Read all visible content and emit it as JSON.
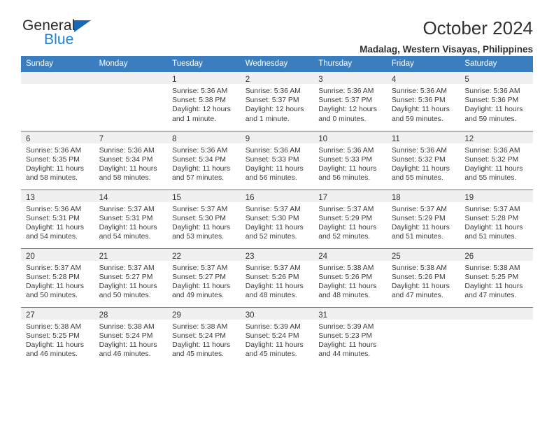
{
  "brand": {
    "name_top": "General",
    "name_bottom": "Blue",
    "accent_color": "#1b84d6",
    "triangle_color": "#1769b5"
  },
  "header": {
    "title": "October 2024",
    "subtitle": "Madalag, Western Visayas, Philippines"
  },
  "calendar": {
    "header_bg": "#3a7ebf",
    "header_text_color": "#ffffff",
    "daynum_band_bg": "#f0f0f0",
    "weekday_headers": [
      "Sunday",
      "Monday",
      "Tuesday",
      "Wednesday",
      "Thursday",
      "Friday",
      "Saturday"
    ],
    "weeks": [
      [
        {
          "day": "",
          "lines": []
        },
        {
          "day": "",
          "lines": []
        },
        {
          "day": "1",
          "lines": [
            "Sunrise: 5:36 AM",
            "Sunset: 5:38 PM",
            "Daylight: 12 hours",
            "and 1 minute."
          ]
        },
        {
          "day": "2",
          "lines": [
            "Sunrise: 5:36 AM",
            "Sunset: 5:37 PM",
            "Daylight: 12 hours",
            "and 1 minute."
          ]
        },
        {
          "day": "3",
          "lines": [
            "Sunrise: 5:36 AM",
            "Sunset: 5:37 PM",
            "Daylight: 12 hours",
            "and 0 minutes."
          ]
        },
        {
          "day": "4",
          "lines": [
            "Sunrise: 5:36 AM",
            "Sunset: 5:36 PM",
            "Daylight: 11 hours",
            "and 59 minutes."
          ]
        },
        {
          "day": "5",
          "lines": [
            "Sunrise: 5:36 AM",
            "Sunset: 5:36 PM",
            "Daylight: 11 hours",
            "and 59 minutes."
          ]
        }
      ],
      [
        {
          "day": "6",
          "lines": [
            "Sunrise: 5:36 AM",
            "Sunset: 5:35 PM",
            "Daylight: 11 hours",
            "and 58 minutes."
          ]
        },
        {
          "day": "7",
          "lines": [
            "Sunrise: 5:36 AM",
            "Sunset: 5:34 PM",
            "Daylight: 11 hours",
            "and 58 minutes."
          ]
        },
        {
          "day": "8",
          "lines": [
            "Sunrise: 5:36 AM",
            "Sunset: 5:34 PM",
            "Daylight: 11 hours",
            "and 57 minutes."
          ]
        },
        {
          "day": "9",
          "lines": [
            "Sunrise: 5:36 AM",
            "Sunset: 5:33 PM",
            "Daylight: 11 hours",
            "and 56 minutes."
          ]
        },
        {
          "day": "10",
          "lines": [
            "Sunrise: 5:36 AM",
            "Sunset: 5:33 PM",
            "Daylight: 11 hours",
            "and 56 minutes."
          ]
        },
        {
          "day": "11",
          "lines": [
            "Sunrise: 5:36 AM",
            "Sunset: 5:32 PM",
            "Daylight: 11 hours",
            "and 55 minutes."
          ]
        },
        {
          "day": "12",
          "lines": [
            "Sunrise: 5:36 AM",
            "Sunset: 5:32 PM",
            "Daylight: 11 hours",
            "and 55 minutes."
          ]
        }
      ],
      [
        {
          "day": "13",
          "lines": [
            "Sunrise: 5:36 AM",
            "Sunset: 5:31 PM",
            "Daylight: 11 hours",
            "and 54 minutes."
          ]
        },
        {
          "day": "14",
          "lines": [
            "Sunrise: 5:37 AM",
            "Sunset: 5:31 PM",
            "Daylight: 11 hours",
            "and 54 minutes."
          ]
        },
        {
          "day": "15",
          "lines": [
            "Sunrise: 5:37 AM",
            "Sunset: 5:30 PM",
            "Daylight: 11 hours",
            "and 53 minutes."
          ]
        },
        {
          "day": "16",
          "lines": [
            "Sunrise: 5:37 AM",
            "Sunset: 5:30 PM",
            "Daylight: 11 hours",
            "and 52 minutes."
          ]
        },
        {
          "day": "17",
          "lines": [
            "Sunrise: 5:37 AM",
            "Sunset: 5:29 PM",
            "Daylight: 11 hours",
            "and 52 minutes."
          ]
        },
        {
          "day": "18",
          "lines": [
            "Sunrise: 5:37 AM",
            "Sunset: 5:29 PM",
            "Daylight: 11 hours",
            "and 51 minutes."
          ]
        },
        {
          "day": "19",
          "lines": [
            "Sunrise: 5:37 AM",
            "Sunset: 5:28 PM",
            "Daylight: 11 hours",
            "and 51 minutes."
          ]
        }
      ],
      [
        {
          "day": "20",
          "lines": [
            "Sunrise: 5:37 AM",
            "Sunset: 5:28 PM",
            "Daylight: 11 hours",
            "and 50 minutes."
          ]
        },
        {
          "day": "21",
          "lines": [
            "Sunrise: 5:37 AM",
            "Sunset: 5:27 PM",
            "Daylight: 11 hours",
            "and 50 minutes."
          ]
        },
        {
          "day": "22",
          "lines": [
            "Sunrise: 5:37 AM",
            "Sunset: 5:27 PM",
            "Daylight: 11 hours",
            "and 49 minutes."
          ]
        },
        {
          "day": "23",
          "lines": [
            "Sunrise: 5:37 AM",
            "Sunset: 5:26 PM",
            "Daylight: 11 hours",
            "and 48 minutes."
          ]
        },
        {
          "day": "24",
          "lines": [
            "Sunrise: 5:38 AM",
            "Sunset: 5:26 PM",
            "Daylight: 11 hours",
            "and 48 minutes."
          ]
        },
        {
          "day": "25",
          "lines": [
            "Sunrise: 5:38 AM",
            "Sunset: 5:26 PM",
            "Daylight: 11 hours",
            "and 47 minutes."
          ]
        },
        {
          "day": "26",
          "lines": [
            "Sunrise: 5:38 AM",
            "Sunset: 5:25 PM",
            "Daylight: 11 hours",
            "and 47 minutes."
          ]
        }
      ],
      [
        {
          "day": "27",
          "lines": [
            "Sunrise: 5:38 AM",
            "Sunset: 5:25 PM",
            "Daylight: 11 hours",
            "and 46 minutes."
          ]
        },
        {
          "day": "28",
          "lines": [
            "Sunrise: 5:38 AM",
            "Sunset: 5:24 PM",
            "Daylight: 11 hours",
            "and 46 minutes."
          ]
        },
        {
          "day": "29",
          "lines": [
            "Sunrise: 5:38 AM",
            "Sunset: 5:24 PM",
            "Daylight: 11 hours",
            "and 45 minutes."
          ]
        },
        {
          "day": "30",
          "lines": [
            "Sunrise: 5:39 AM",
            "Sunset: 5:24 PM",
            "Daylight: 11 hours",
            "and 45 minutes."
          ]
        },
        {
          "day": "31",
          "lines": [
            "Sunrise: 5:39 AM",
            "Sunset: 5:23 PM",
            "Daylight: 11 hours",
            "and 44 minutes."
          ]
        },
        {
          "day": "",
          "lines": []
        },
        {
          "day": "",
          "lines": []
        }
      ]
    ]
  }
}
